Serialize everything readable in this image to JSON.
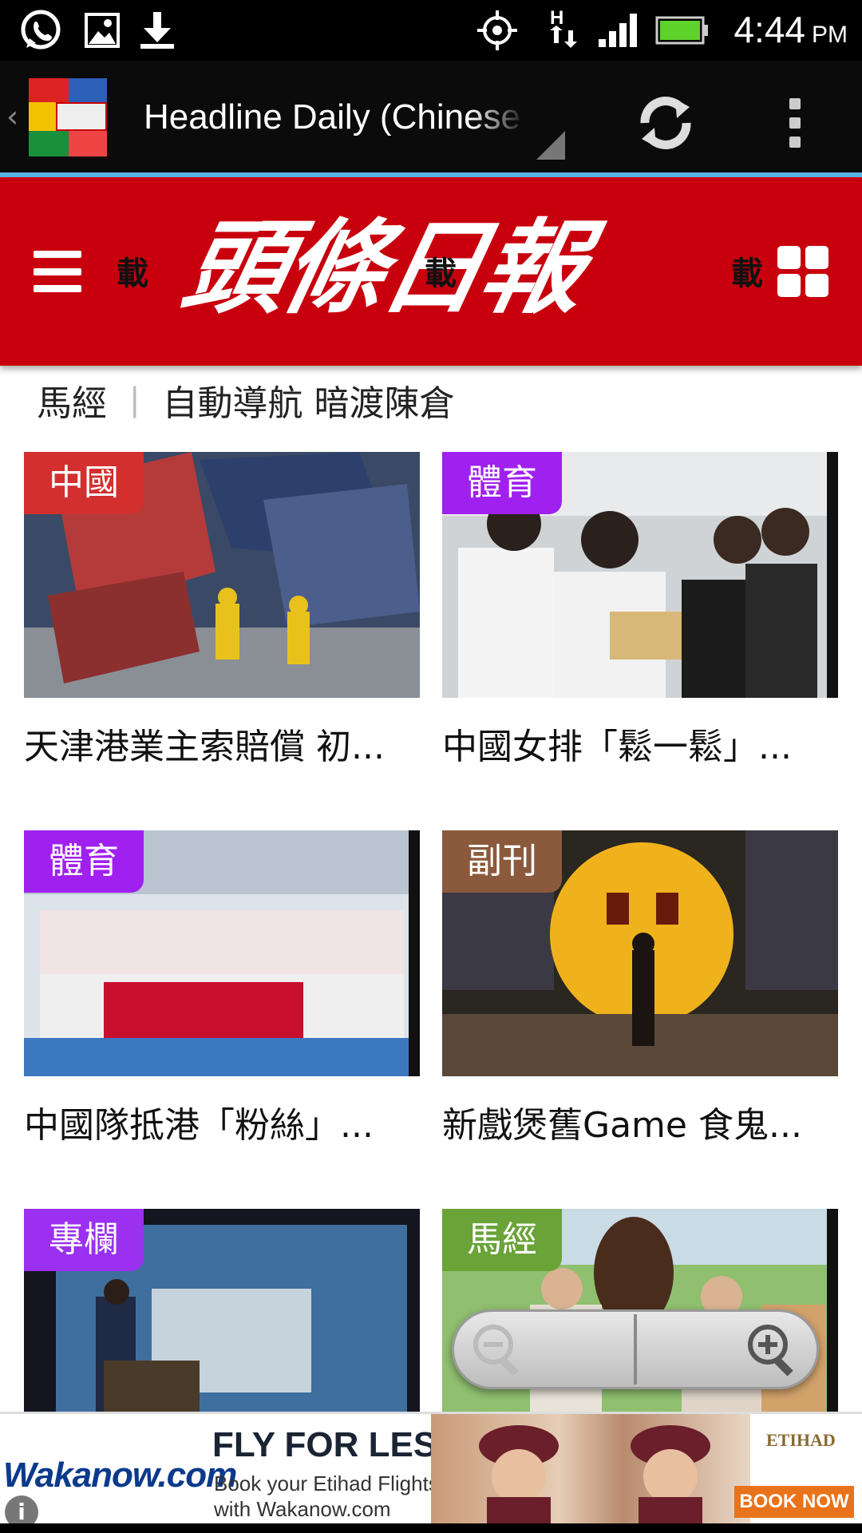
{
  "status_bar": {
    "time": "4:44",
    "ampm": "PM",
    "icons": [
      "whatsapp-icon",
      "image-icon",
      "download-icon",
      "gps-icon",
      "hspa-data-icon",
      "signal-icon",
      "battery-icon"
    ]
  },
  "action_bar": {
    "title": "Headline Daily (Chinese",
    "refresh_icon": "refresh-icon",
    "overflow_icon": "overflow-menu-icon"
  },
  "site_header": {
    "logo_text": "頭條日報",
    "loading_glyph": "載",
    "menu_icon": "hamburger-menu-icon",
    "grid_icon": "grid-view-icon",
    "brand_color": "#c8000e"
  },
  "ticker": {
    "category": "馬經",
    "separator": "|",
    "headline": "自動導航 暗渡陳倉"
  },
  "articles": [
    {
      "badge": "中國",
      "badge_color": "#d32f2f",
      "caption": "天津港業主索賠償 初..."
    },
    {
      "badge": "體育",
      "badge_color": "#a020f0",
      "caption": "中國女排「鬆一鬆」..."
    },
    {
      "badge": "體育",
      "badge_color": "#a020f0",
      "caption": "中國隊抵港「粉絲」..."
    },
    {
      "badge": "副刊",
      "badge_color": "#8b5a3c",
      "caption": "新戲煲舊Game 食鬼..."
    },
    {
      "badge": "專欄",
      "badge_color": "#9b30f0",
      "caption": ""
    },
    {
      "badge": "馬經",
      "badge_color": "#6aa337",
      "caption": ""
    }
  ],
  "zoom": {
    "zoom_out_icon": "zoom-out-icon",
    "zoom_in_icon": "zoom-in-icon"
  },
  "ad": {
    "brand": "Wakanow.com",
    "headline": "FLY FOR LESS",
    "sub1": "Book your Etihad Flights",
    "sub2": "with Wakanow.com",
    "airline": "ETIHAD",
    "cta": "BOOK NOW",
    "info_icon": "info-icon"
  }
}
